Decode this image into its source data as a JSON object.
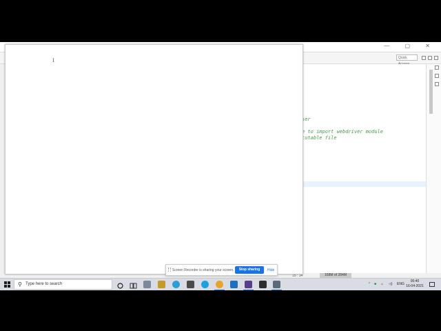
{
  "eclipse": {
    "quick_access": "Quick Access",
    "code_lines": [
      "ser",
      "e to import webdriver module",
      "cutable file"
    ],
    "status": {
      "position": "15 : 14",
      "heap": "168M of 284M"
    }
  },
  "screen_share": {
    "message": "Screen Recorder is sharing your screen.",
    "stop_label": "Stop sharing",
    "hide_label": "Hide"
  },
  "taskbar": {
    "search_placeholder": "Type here to search",
    "language": "ENG",
    "time": "00:40",
    "date": "16-04-2021",
    "apps": [
      {
        "name": "cortana-icon",
        "color": "#222"
      },
      {
        "name": "task-view-icon",
        "color": "#333"
      },
      {
        "name": "file-explorer-icon",
        "color": "#7a8a9a"
      },
      {
        "name": "store-icon",
        "color": "#c69a28"
      },
      {
        "name": "edge-icon",
        "color": "#2b9ed7"
      },
      {
        "name": "mail-icon",
        "color": "#4a4a4a"
      },
      {
        "name": "skype-icon",
        "color": "#1ba1e2"
      },
      {
        "name": "chrome-icon",
        "color": "#e5a42a"
      },
      {
        "name": "outlook-mail-icon",
        "color": "#1f6fbf"
      },
      {
        "name": "recorder-icon",
        "color": "#5b3e8a"
      },
      {
        "name": "camera-icon",
        "color": "#2d2d2d"
      },
      {
        "name": "eclipse-icon",
        "color": "#5a6a7a"
      }
    ]
  }
}
